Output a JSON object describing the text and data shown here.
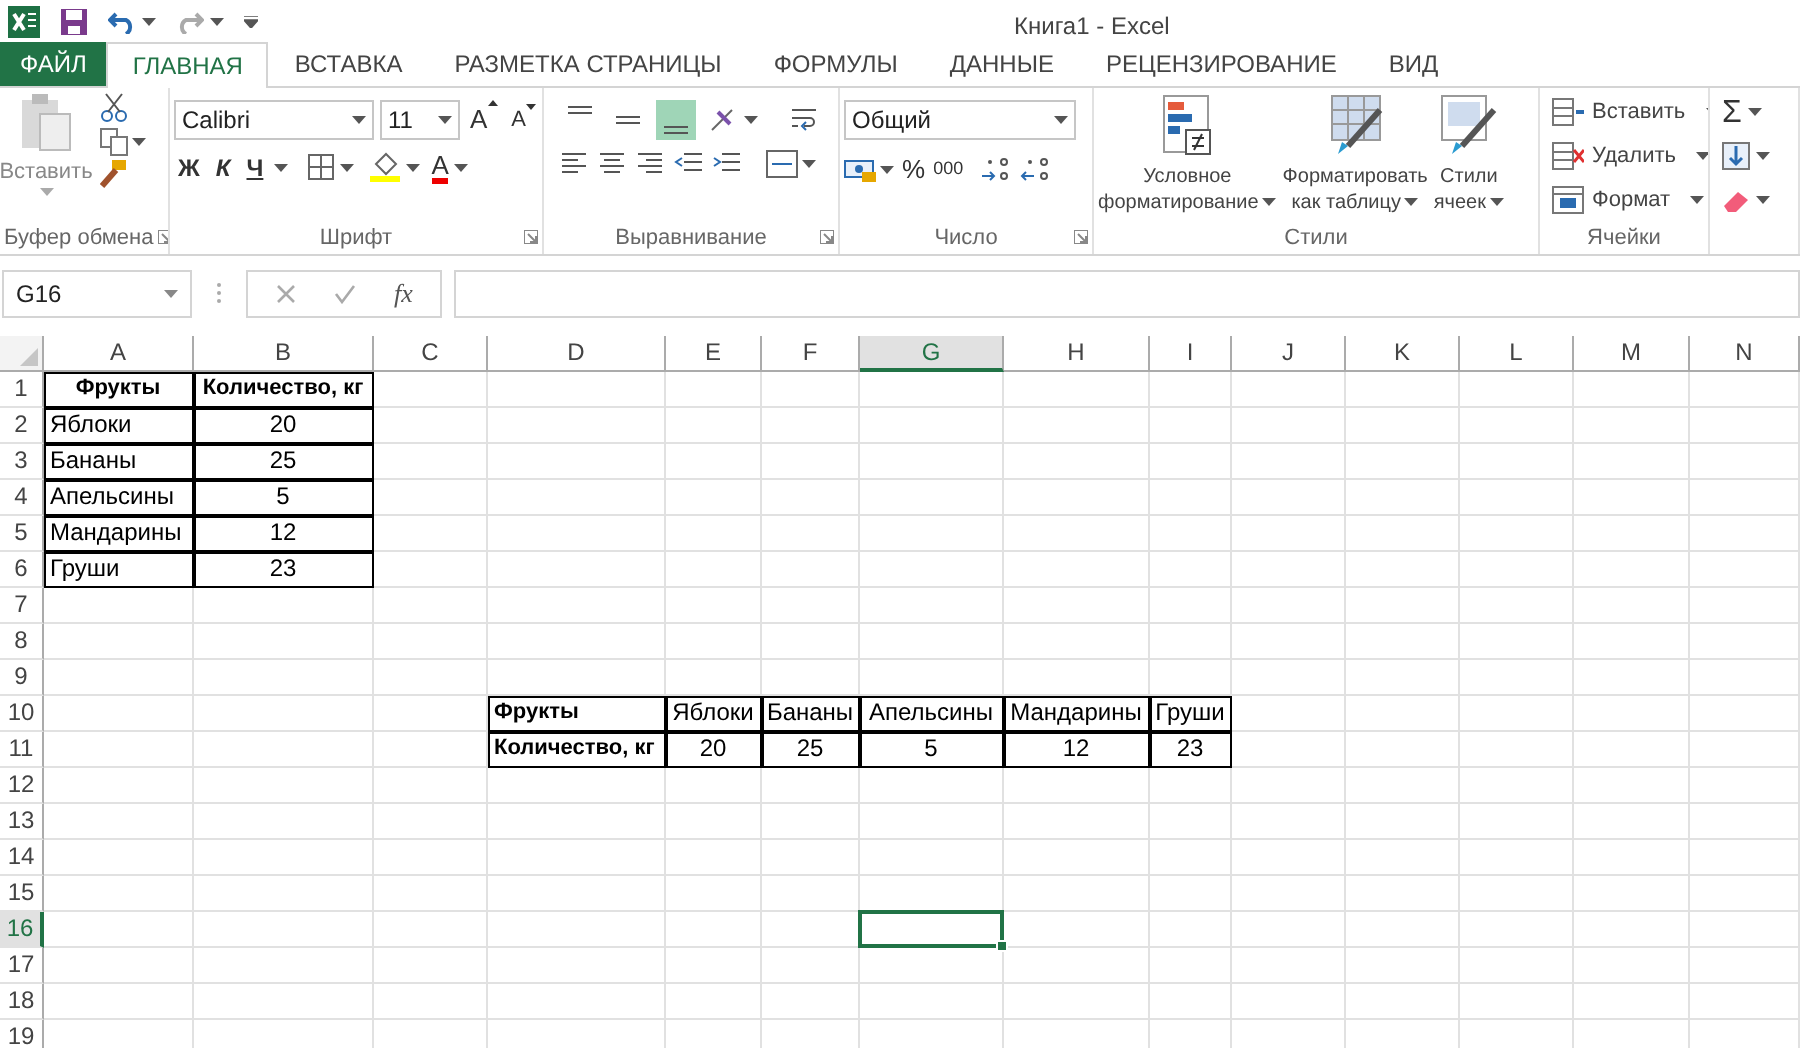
{
  "window": {
    "title": "Книга1 - Excel"
  },
  "tabs": [
    {
      "label": "ФАЙЛ",
      "kind": "file",
      "selected": false
    },
    {
      "label": "ГЛАВНАЯ",
      "kind": "tab",
      "selected": true
    },
    {
      "label": "ВСТАВКА",
      "kind": "tab",
      "selected": false
    },
    {
      "label": "РАЗМЕТКА СТРАНИЦЫ",
      "kind": "tab",
      "selected": false
    },
    {
      "label": "ФОРМУЛЫ",
      "kind": "tab",
      "selected": false
    },
    {
      "label": "ДАННЫЕ",
      "kind": "tab",
      "selected": false
    },
    {
      "label": "РЕЦЕНЗИРОВАНИЕ",
      "kind": "tab",
      "selected": false
    },
    {
      "label": "ВИД",
      "kind": "tab",
      "selected": false
    }
  ],
  "ribbon": {
    "clipboard": {
      "paste_label": "Вставить",
      "group_label": "Буфер обмена"
    },
    "font": {
      "font_name": "Calibri",
      "font_size": "11",
      "grow": "A",
      "shrink": "A",
      "bold": "Ж",
      "italic": "К",
      "underline": "Ч",
      "font_color": "A",
      "group_label": "Шрифт"
    },
    "alignment": {
      "vertical": [
        {
          "selected": false
        },
        {
          "selected": false
        },
        {
          "selected": true
        }
      ],
      "group_label": "Выравнивание"
    },
    "number": {
      "format": "Общий",
      "percent": "%",
      "thousands": "000",
      "group_label": "Число"
    },
    "styles": {
      "buttons": [
        {
          "lines": [
            "Условное",
            "форматирование"
          ]
        },
        {
          "lines": [
            "Форматировать",
            "как таблицу"
          ]
        },
        {
          "lines": [
            "Стили",
            "ячеек"
          ]
        }
      ],
      "group_label": "Стили"
    },
    "cells": {
      "buttons": [
        "Вставить",
        "Удалить",
        "Формат"
      ],
      "group_label": "Ячейки"
    },
    "editing": {
      "autosum": "Σ"
    }
  },
  "formula_bar": {
    "name_box": "G16",
    "function_label": "fx"
  },
  "sheet": {
    "columns": [
      {
        "label": "A",
        "selected": false
      },
      {
        "label": "B",
        "selected": false
      },
      {
        "label": "C",
        "selected": false
      },
      {
        "label": "D",
        "selected": false
      },
      {
        "label": "E",
        "selected": false
      },
      {
        "label": "F",
        "selected": false
      },
      {
        "label": "G",
        "selected": true
      },
      {
        "label": "H",
        "selected": false
      },
      {
        "label": "I",
        "selected": false
      },
      {
        "label": "J",
        "selected": false
      },
      {
        "label": "K",
        "selected": false
      },
      {
        "label": "L",
        "selected": false
      },
      {
        "label": "M",
        "selected": false
      },
      {
        "label": "N",
        "selected": false
      }
    ],
    "rows": [
      {
        "label": "1",
        "selected": false
      },
      {
        "label": "2",
        "selected": false
      },
      {
        "label": "3",
        "selected": false
      },
      {
        "label": "4",
        "selected": false
      },
      {
        "label": "5",
        "selected": false
      },
      {
        "label": "6",
        "selected": false
      },
      {
        "label": "7",
        "selected": false
      },
      {
        "label": "8",
        "selected": false
      },
      {
        "label": "9",
        "selected": false
      },
      {
        "label": "10",
        "selected": false
      },
      {
        "label": "11",
        "selected": false
      },
      {
        "label": "12",
        "selected": false
      },
      {
        "label": "13",
        "selected": false
      },
      {
        "label": "14",
        "selected": false
      },
      {
        "label": "15",
        "selected": false
      },
      {
        "label": "16",
        "selected": true
      },
      {
        "label": "17",
        "selected": false
      },
      {
        "label": "18",
        "selected": false
      },
      {
        "label": "19",
        "selected": false
      }
    ],
    "tables": [
      {
        "kind": "vertical",
        "rows": [
          [
            "Фрукты",
            "Количество, кг"
          ],
          [
            "Яблоки",
            "20"
          ],
          [
            "Бананы",
            "25"
          ],
          [
            "Апельсины",
            "5"
          ],
          [
            "Мандарины",
            "12"
          ],
          [
            "Груши",
            "23"
          ]
        ]
      },
      {
        "kind": "horizontal",
        "rows": [
          [
            "Фрукты",
            "Яблоки",
            "Бананы",
            "Апельсины",
            "Мандарины",
            "Груши"
          ],
          [
            "Количество, кг",
            "20",
            "25",
            "5",
            "12",
            "23"
          ]
        ]
      }
    ]
  }
}
